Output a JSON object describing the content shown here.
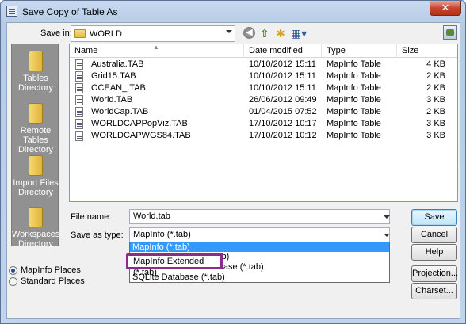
{
  "window": {
    "title": "Save Copy of Table As",
    "close_glyph": "✕"
  },
  "toolbar": {
    "save_in_label": "Save in:",
    "save_in_value": "WORLD",
    "icons": [
      "back-icon",
      "up-folder-icon",
      "new-folder-icon",
      "views-menu-icon",
      "network-icon"
    ]
  },
  "places": [
    {
      "label": "Tables Directory"
    },
    {
      "label": "Remote Tables Directory"
    },
    {
      "label": "Import Files Directory"
    },
    {
      "label": "Workspaces Directory"
    }
  ],
  "filelist": {
    "columns": [
      "Name",
      "Date modified",
      "Type",
      "Size"
    ],
    "rows": [
      {
        "name": "Australia.TAB",
        "date": "10/10/2012 15:11",
        "type": "MapInfo Table",
        "size": "4 KB"
      },
      {
        "name": "Grid15.TAB",
        "date": "10/10/2012 15:11",
        "type": "MapInfo Table",
        "size": "2 KB"
      },
      {
        "name": "OCEAN_.TAB",
        "date": "10/10/2012 15:11",
        "type": "MapInfo Table",
        "size": "2 KB"
      },
      {
        "name": "World.TAB",
        "date": "26/06/2012 09:49",
        "type": "MapInfo Table",
        "size": "3 KB"
      },
      {
        "name": "WorldCap.TAB",
        "date": "01/04/2015 07:52",
        "type": "MapInfo Table",
        "size": "2 KB"
      },
      {
        "name": "WORLDCAPPopViz.TAB",
        "date": "17/10/2012 10:17",
        "type": "MapInfo Table",
        "size": "3 KB"
      },
      {
        "name": "WORLDCAPWGS84.TAB",
        "date": "17/10/2012 10:12",
        "type": "MapInfo Table",
        "size": "3 KB"
      }
    ]
  },
  "form": {
    "file_name_label": "File name:",
    "file_name_value": "World.tab",
    "save_type_label": "Save as type:",
    "save_type_value": "MapInfo (*.tab)"
  },
  "dropdown": {
    "options": [
      "MapInfo (*.tab)",
      "MapInfo Extended (*.tab)",
      "Microsoft Access Database (*.tab)",
      "SQLite Database (*.tab)"
    ],
    "selected_index": 0,
    "highlighted": "MapInfo Extended (*.tab)"
  },
  "buttons": {
    "save": "Save",
    "cancel": "Cancel",
    "help": "Help",
    "projection": "Projection...",
    "charset": "Charset..."
  },
  "radios": [
    {
      "label": "MapInfo Places",
      "checked": true
    },
    {
      "label": "Standard Places",
      "checked": false
    }
  ],
  "colors": {
    "highlight_border": "#8d2a8c",
    "selection": "#3399ff",
    "places_bar": "#919191"
  }
}
